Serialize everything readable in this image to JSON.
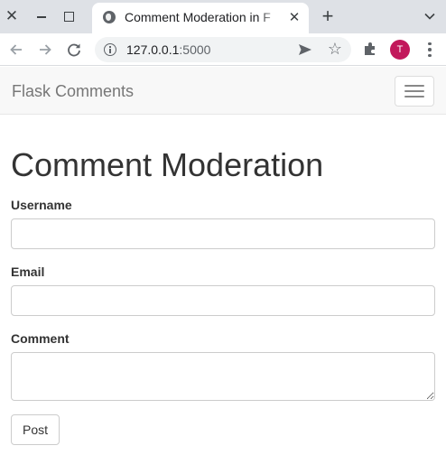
{
  "browser": {
    "tab": {
      "title": "Comment Moderation in F",
      "favicon": "globe-icon"
    },
    "url": {
      "host": "127.0.0.1",
      "port": ":5000"
    },
    "profile_initial": "T",
    "colors": {
      "tabbar": "#dee1e6",
      "avatar": "#c2185b"
    }
  },
  "navbar": {
    "brand": "Flask Comments"
  },
  "main": {
    "title": "Comment Moderation",
    "form": {
      "username_label": "Username",
      "username_value": "",
      "email_label": "Email",
      "email_value": "",
      "comment_label": "Comment",
      "comment_value": "",
      "submit_label": "Post"
    }
  }
}
